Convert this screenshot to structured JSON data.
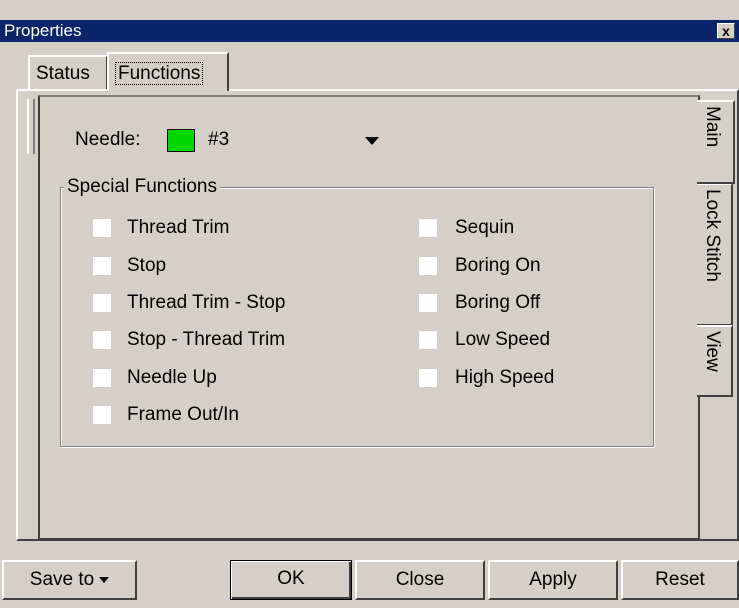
{
  "window": {
    "title": "Properties",
    "close_label": "x"
  },
  "top_tabs": [
    {
      "label": "Status"
    },
    {
      "label": "Functions"
    }
  ],
  "needle": {
    "label": "Needle:",
    "value": "#3",
    "swatch_color": "#00d600"
  },
  "special_functions": {
    "legend": "Special Functions",
    "left": [
      "Thread Trim",
      "Stop",
      "Thread Trim - Stop",
      "Stop - Thread Trim",
      "Needle Up",
      "Frame Out/In"
    ],
    "right": [
      "Sequin",
      "Boring On",
      "Boring Off",
      "Low Speed",
      "High Speed"
    ]
  },
  "side_tabs": [
    {
      "label": "Main"
    },
    {
      "label": "Lock Stitch"
    },
    {
      "label": "View"
    }
  ],
  "buttons": {
    "save_to": "Save to",
    "ok": "OK",
    "close": "Close",
    "apply": "Apply",
    "reset": "Reset"
  }
}
